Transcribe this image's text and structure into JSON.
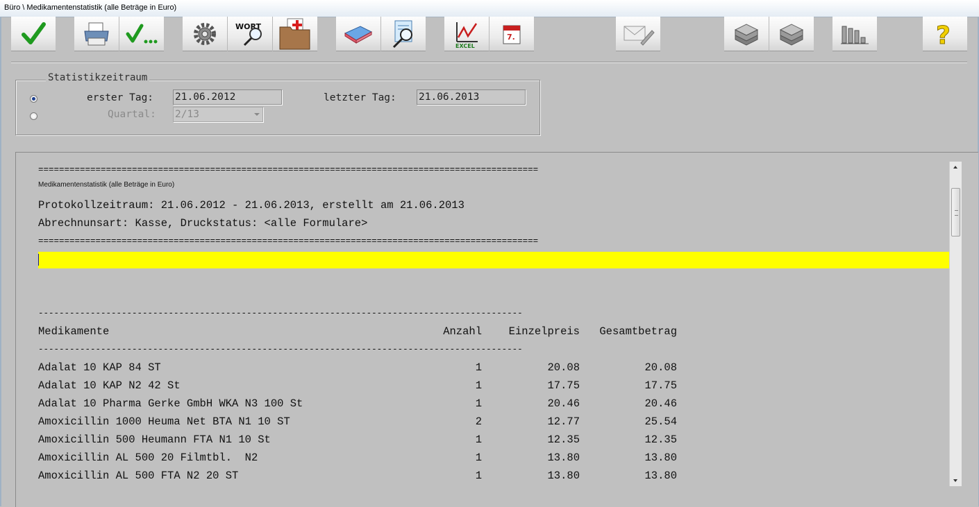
{
  "window": {
    "title": "Büro \\ Medikamentenstatistik (alle Beträge in Euro)"
  },
  "toolbar": {
    "buttons": [
      {
        "name": "ok-button",
        "icon": "checkmark-icon"
      },
      {
        "name": "print-button",
        "icon": "printer-icon"
      },
      {
        "name": "check-more-button",
        "icon": "checkmark-ellipsis-icon"
      },
      {
        "name": "settings-button",
        "icon": "gear-icon"
      },
      {
        "name": "word-search-button",
        "icon": "word-magnifier-icon",
        "text": "WORT"
      },
      {
        "name": "patient-folder-button",
        "icon": "medical-folder-icon"
      },
      {
        "name": "eraser-button",
        "icon": "eraser-icon"
      },
      {
        "name": "document-search-button",
        "icon": "document-magnifier-icon"
      },
      {
        "name": "excel-export-button",
        "icon": "excel-chart-icon",
        "text": "EXCEL"
      },
      {
        "name": "calendar-button",
        "icon": "calendar-icon",
        "text": "7."
      },
      {
        "name": "mail-button",
        "icon": "envelope-pen-icon"
      },
      {
        "name": "tray-1-button",
        "icon": "stacked-tray-icon"
      },
      {
        "name": "tray-2-button",
        "icon": "stacked-tray-icon"
      },
      {
        "name": "bar-chart-button",
        "icon": "bar-chart-icon"
      },
      {
        "name": "help-button",
        "icon": "question-mark-icon",
        "text": "?"
      }
    ]
  },
  "period": {
    "legend": "Statistikzeitraum",
    "first_day_label": "erster Tag:",
    "first_day_value": "21.06.2012",
    "last_day_label": "letzter Tag:",
    "last_day_value": "21.06.2013",
    "quarter_label": "Quartal:",
    "quarter_value": "2/13",
    "selected": "date-range"
  },
  "report": {
    "rule_double": "================================================================================================",
    "title_small": "Medikamentenstatistik (alle Beträge in Euro)",
    "line_period": "Protokollzeitraum: 21.06.2012 - 21.06.2013, erstellt am 21.06.2013",
    "line_billing": "Abrechnunsart: Kasse, Druckstatus: <alle Formulare>",
    "rule_single": "---------------------------------------------------------------------------------------------",
    "columns": {
      "name": "Medikamente",
      "count": "Anzahl",
      "unit": "Einzelpreis",
      "total": "Gesamtbetrag"
    },
    "rows": [
      {
        "name": "Adalat 10 KAP 84 ST",
        "count": "1",
        "unit": "20.08",
        "total": "20.08"
      },
      {
        "name": "Adalat 10 KAP N2 42 St",
        "count": "1",
        "unit": "17.75",
        "total": "17.75"
      },
      {
        "name": "Adalat 10 Pharma Gerke GmbH WKA N3 100 St",
        "count": "1",
        "unit": "20.46",
        "total": "20.46"
      },
      {
        "name": "Amoxicillin 1000 Heuma Net BTA N1 10 ST",
        "count": "2",
        "unit": "12.77",
        "total": "25.54"
      },
      {
        "name": "Amoxicillin 500 Heumann FTA N1 10 St",
        "count": "1",
        "unit": "12.35",
        "total": "12.35"
      },
      {
        "name": "Amoxicillin AL 500 20 Filmtbl.  N2",
        "count": "1",
        "unit": "13.80",
        "total": "13.80"
      },
      {
        "name": "Amoxicillin AL 500 FTA N2 20 ST",
        "count": "1",
        "unit": "13.80",
        "total": "13.80"
      }
    ]
  },
  "colors": {
    "background": "#c0c0c0",
    "highlight": "#ffff00"
  }
}
